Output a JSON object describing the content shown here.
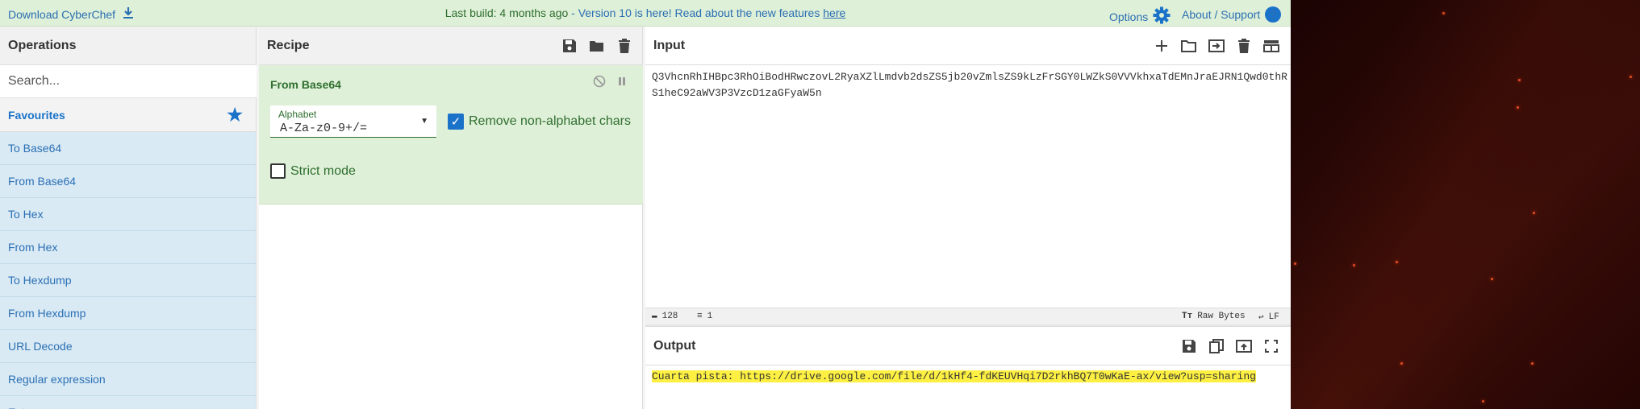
{
  "banner": {
    "download_label": "Download CyberChef",
    "build_prefix": "Last build: 4 months ago",
    "build_message": " - Version 10 is here! Read about the new features ",
    "build_link": "here",
    "options_label": "Options",
    "about_label": "About / Support",
    "about_icon_glyph": "?"
  },
  "operations": {
    "title": "Operations",
    "search_placeholder": "Search...",
    "favourites_label": "Favourites",
    "items": [
      "To Base64",
      "From Base64",
      "To Hex",
      "From Hex",
      "To Hexdump",
      "From Hexdump",
      "URL Decode",
      "Regular expression",
      "Entropy"
    ]
  },
  "recipe": {
    "title": "Recipe",
    "operation": {
      "name": "From Base64",
      "alphabet_label": "Alphabet",
      "alphabet_value": "A-Za-z0-9+/=",
      "remove_nonalpha_label": "Remove non-alphabet chars",
      "remove_nonalpha_checked": true,
      "strict_mode_label": "Strict mode",
      "strict_mode_checked": false
    }
  },
  "input": {
    "title": "Input",
    "text": "Q3VhcnRhIHBpc3RhOiBodHRwczovL2RyaXZlLmdvb2dsZS5jb20vZmlsZS9kLzFrSGY0LWZkS0VVVkhxaTdEMnJraEJRN1Qwd0thRS1heC92aWV3P3VzcD1zaGFyaW5n",
    "status_chars": "128",
    "status_lines": "1",
    "status_encoding": "Raw Bytes",
    "status_eol": "LF"
  },
  "output": {
    "title": "Output",
    "text": "Cuarta pista: https://drive.google.com/file/d/1kHf4-fdKEUVHqi7D2rkhBQ7T0wKaE-ax/view?usp=sharing"
  },
  "colors": {
    "banner_bg": "#dff0d8",
    "accent": "#1a73c9",
    "recipe_op_bg": "#dff0d8",
    "op_item_bg": "#d9eaf5",
    "output_highlight": "#fdf042"
  }
}
